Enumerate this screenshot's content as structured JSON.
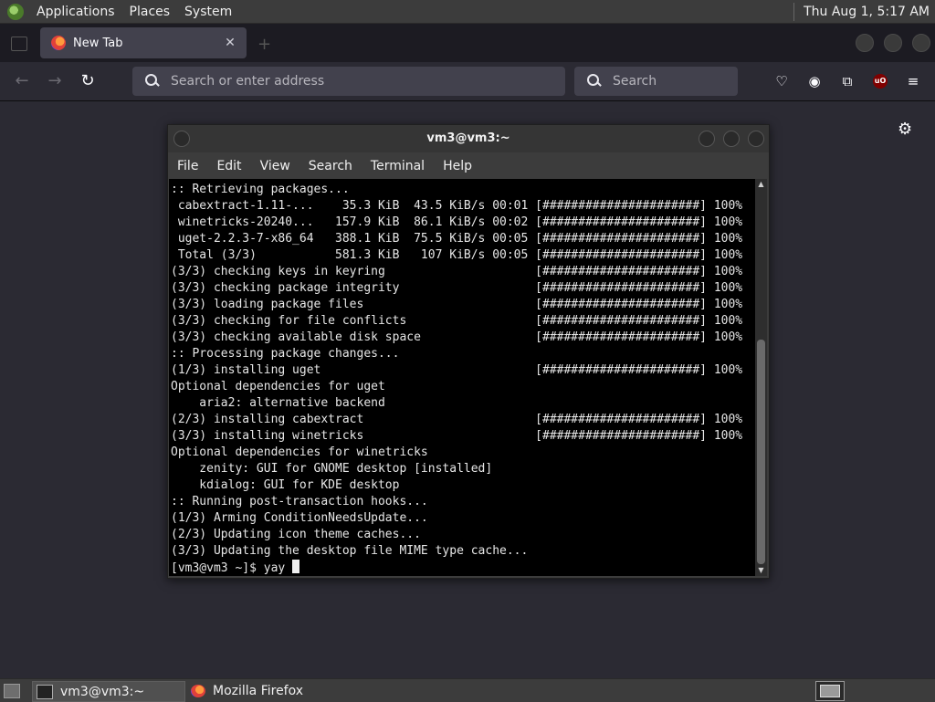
{
  "top_panel": {
    "applications": "Applications",
    "places": "Places",
    "system": "System",
    "clock": "Thu Aug  1,  5:17 AM"
  },
  "browser": {
    "tab_title": "New Tab",
    "url_placeholder": "Search or enter address",
    "search_placeholder": "Search",
    "ublock_badge": "uO"
  },
  "terminal": {
    "title": "vm3@vm3:~",
    "menu": [
      "File",
      "Edit",
      "View",
      "Search",
      "Terminal",
      "Help"
    ],
    "output": ":: Retrieving packages...\n cabextract-1.11-...    35.3 KiB  43.5 KiB/s 00:01 [######################] 100%\n winetricks-20240...   157.9 KiB  86.1 KiB/s 00:02 [######################] 100%\n uget-2.2.3-7-x86_64   388.1 KiB  75.5 KiB/s 00:05 [######################] 100%\n Total (3/3)           581.3 KiB   107 KiB/s 00:05 [######################] 100%\n(3/3) checking keys in keyring                     [######################] 100%\n(3/3) checking package integrity                   [######################] 100%\n(3/3) loading package files                        [######################] 100%\n(3/3) checking for file conflicts                  [######################] 100%\n(3/3) checking available disk space                [######################] 100%\n:: Processing package changes...\n(1/3) installing uget                              [######################] 100%\nOptional dependencies for uget\n    aria2: alternative backend\n(2/3) installing cabextract                        [######################] 100%\n(3/3) installing winetricks                        [######################] 100%\nOptional dependencies for winetricks\n    zenity: GUI for GNOME desktop [installed]\n    kdialog: GUI for KDE desktop\n:: Running post-transaction hooks...\n(1/3) Arming ConditionNeedsUpdate...\n(2/3) Updating icon theme caches...\n(3/3) Updating the desktop file MIME type cache...",
    "prompt": "[vm3@vm3 ~]$ yay "
  },
  "taskbar": {
    "terminal_task": "vm3@vm3:~",
    "firefox_task": "Mozilla Firefox"
  },
  "icons": {
    "back": "left-arrow-icon",
    "forward": "right-arrow-icon",
    "reload": "reload-icon",
    "pocket": "pocket-icon",
    "account": "account-icon",
    "extensions": "puzzle-icon",
    "menu": "hamburger-icon",
    "settings": "gear-icon"
  }
}
